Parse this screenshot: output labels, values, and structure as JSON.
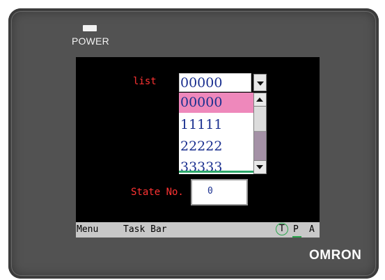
{
  "device": {
    "power_label": "POWER",
    "brand": "OMRON"
  },
  "screen": {
    "list_label": "list",
    "combo": {
      "value": "00000",
      "options": [
        "00000",
        "11111",
        "22222",
        "33333"
      ],
      "selected_index": 0
    },
    "state_label": "State No.",
    "state_value": "0"
  },
  "taskbar": {
    "menu": "Menu",
    "task_bar": "Task Bar",
    "t": "T",
    "p": "P",
    "a": "A"
  },
  "colors": {
    "label_red": "#ff3333",
    "value_blue": "#1a2f8f",
    "selected_row": "#ee88bb",
    "taskbar_bg": "#c8c8c8",
    "bezel": "#525252"
  }
}
